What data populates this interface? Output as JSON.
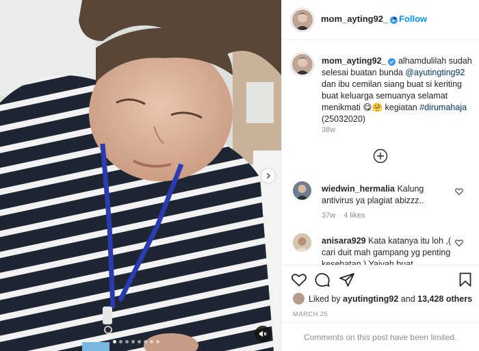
{
  "post": {
    "username": "mom_ayting92_",
    "separator": "•",
    "follow_label": "Follow",
    "caption_parts": {
      "text1": " alhamdulilah sudah selesai buatan bunda ",
      "mention": "@ayutingting92",
      "text2": " dan ibu cemilan siang buat si keriting buat keluarga semuanya selamat menikmati 😋🤗 kegiatan ",
      "hashtag": "#dirumahaja",
      "text3": " (25032020)"
    },
    "caption_time": "38w"
  },
  "comments": [
    {
      "username": "wiedwin_hermalia",
      "text": " Kalung antivirus ya plagiat abizzz..",
      "time": "37w",
      "likes": "4 likes"
    },
    {
      "username": "anisara929",
      "text": " Kata katanya itu loh ,( cari duit mah gampang yg penting kesehatan ) Yaiyah buat"
    }
  ],
  "likes": {
    "prefix": "Liked by ",
    "user": "ayutingting92",
    "middle": " and ",
    "count": "13,428 others"
  },
  "date": "MARCH 25",
  "comments_limited": "Comments on this post have been limited.",
  "icons": {
    "verified": "verified-badge-icon",
    "more": "plus-circle-icon",
    "like": "heart-icon",
    "comment": "comment-bubble-icon",
    "share": "paper-plane-icon",
    "save": "bookmark-icon",
    "mute": "speaker-muted-icon",
    "next": "chevron-right-icon"
  },
  "colors": {
    "link_blue": "#0095f6",
    "verified_blue": "#3897f0",
    "mention": "#00376b",
    "muted_text": "#8e8e8e"
  },
  "carousel": {
    "slide_count": 8,
    "active_index": 0
  }
}
